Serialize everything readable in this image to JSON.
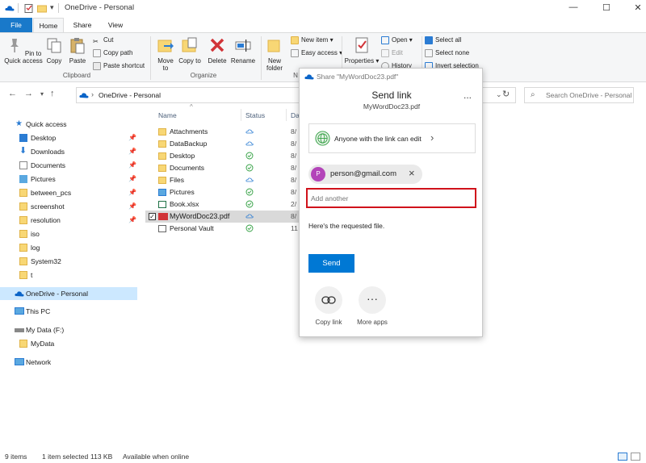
{
  "window": {
    "title": "OneDrive - Personal"
  },
  "ribbon_tabs": [
    "File",
    "Home",
    "Share",
    "View"
  ],
  "ribbon": {
    "pin_label": "Pin to Quick access",
    "copy_label": "Copy",
    "paste_label": "Paste",
    "cut_label": "Cut",
    "copy_path_label": "Copy path",
    "paste_shortcut_label": "Paste shortcut",
    "clipboard_group": "Clipboard",
    "move_to_label": "Move to",
    "copy_to_label": "Copy to",
    "delete_label": "Delete",
    "rename_label": "Rename",
    "organize_group": "Organize",
    "new_folder_label": "New folder",
    "new_item_label": "New item",
    "easy_access_label": "Easy access",
    "new_group": "N",
    "properties_label": "Properties",
    "open_label": "Open",
    "edit_label": "Edit",
    "history_label": "History",
    "select_all_label": "Select all",
    "select_none_label": "Select none",
    "invert_selection_label": "Invert selection"
  },
  "address": {
    "path": "OneDrive - Personal",
    "search_placeholder": "Search OneDrive - Personal"
  },
  "nav": {
    "quick_access": "Quick access",
    "quick_items": [
      "Desktop",
      "Downloads",
      "Documents",
      "Pictures",
      "between_pcs",
      "screenshot",
      "resolution",
      "iso",
      "log",
      "System32",
      "t"
    ],
    "onedrive": "OneDrive - Personal",
    "this_pc": "This PC",
    "drive": "My Data (F:)",
    "drive_folder": "MyData",
    "network": "Network"
  },
  "columns": {
    "name": "Name",
    "status": "Status",
    "date": "Da"
  },
  "files": [
    {
      "name": "Attachments",
      "date": "8/"
    },
    {
      "name": "DataBackup",
      "date": "8/"
    },
    {
      "name": "Desktop",
      "date": "8/"
    },
    {
      "name": "Documents",
      "date": "8/"
    },
    {
      "name": "Files",
      "date": "8/"
    },
    {
      "name": "Pictures",
      "date": "8/"
    },
    {
      "name": "Book.xlsx",
      "date": "2/"
    },
    {
      "name": "MyWordDoc23.pdf",
      "date": "8/"
    },
    {
      "name": "Personal Vault",
      "date": "11"
    }
  ],
  "status_bar": {
    "count": "9 items",
    "selected": "1 item selected",
    "size": "113 KB",
    "availability": "Available when online"
  },
  "share_dialog": {
    "window_title": "Share \"MyWordDoc23.pdf\"",
    "title": "Send link",
    "filename": "MyWordDoc23.pdf",
    "more": "...",
    "link_setting": "Anyone with the link can edit",
    "chevron": "›",
    "recipient_initial": "P",
    "recipient_email": "person@gmail.com",
    "remove": "×",
    "add_placeholder": "Add another",
    "message": "Here's the requested file.",
    "send_label": "Send",
    "copy_link_label": "Copy link",
    "more_apps_label": "More apps"
  },
  "colors": {
    "accent": "#0078d4",
    "file_tab": "#1979ca",
    "highlight_border": "#d0121b",
    "selected_row": "#cce8ff",
    "recipient_avatar": "#b344b9"
  }
}
